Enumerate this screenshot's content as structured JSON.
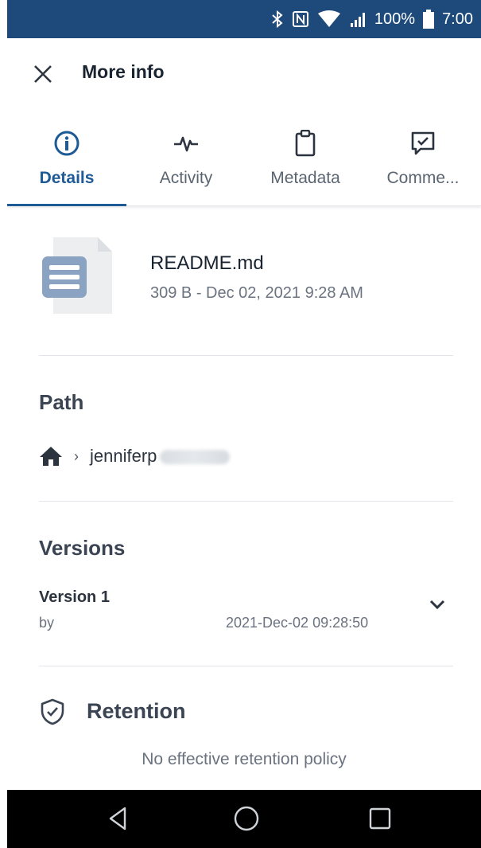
{
  "status_bar": {
    "battery": "100%",
    "time": "7:00"
  },
  "header": {
    "title": "More info"
  },
  "tabs": [
    {
      "label": "Details",
      "icon": "info-icon",
      "active": true
    },
    {
      "label": "Activity",
      "icon": "activity-icon",
      "active": false
    },
    {
      "label": "Metadata",
      "icon": "clipboard-icon",
      "active": false
    },
    {
      "label": "Comme...",
      "icon": "comment-check-icon",
      "active": false
    }
  ],
  "file": {
    "name": "README.md",
    "meta": "309 B - Dec 02, 2021 9:28 AM",
    "icon": "document-icon"
  },
  "path": {
    "title": "Path",
    "segment": "jenniferp"
  },
  "versions": {
    "title": "Versions",
    "item": {
      "name": "Version 1",
      "by": "by",
      "date": "2021-Dec-02 09:28:50"
    }
  },
  "retention": {
    "title": "Retention",
    "text": "No effective retention policy"
  },
  "colors": {
    "status_bar": "#1d4a7a",
    "accent": "#1d5a96",
    "icon_blue": "#8aa3c2"
  }
}
